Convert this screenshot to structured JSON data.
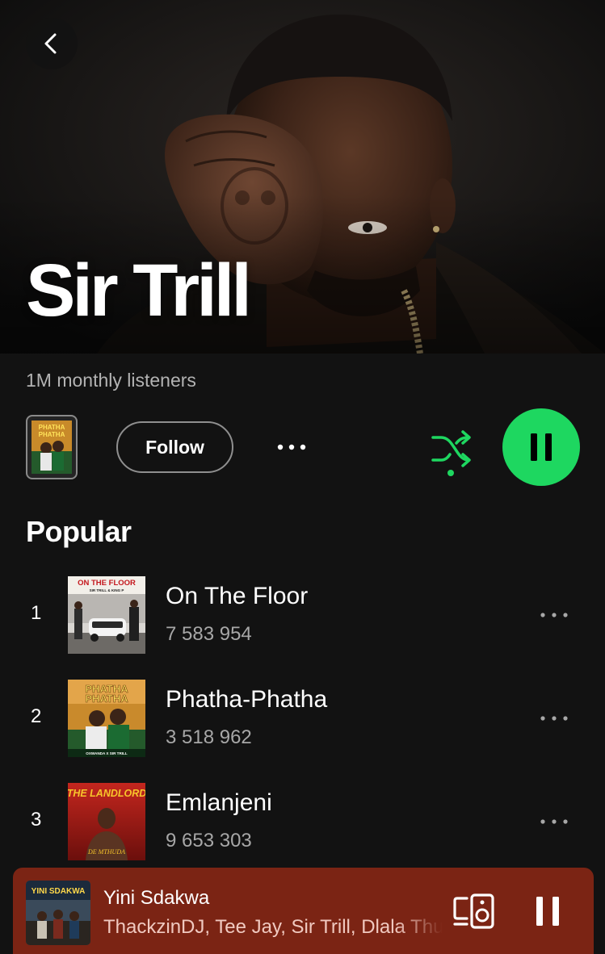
{
  "header": {
    "artist_name": "Sir Trill",
    "back_icon": "chevron-left-icon"
  },
  "artist_info": {
    "monthly_listeners": "1M monthly listeners"
  },
  "actions": {
    "mini_cover_lines": [
      "PHATHA",
      "PHATHA"
    ],
    "follow_label": "Follow",
    "more_icon": "more-horizontal-icon",
    "shuffle_icon": "shuffle-icon",
    "play_state_icon": "pause-icon"
  },
  "popular": {
    "heading": "Popular",
    "tracks": [
      {
        "rank": "1",
        "title": "On The Floor",
        "plays": "7 583 954",
        "cover_lines": [
          "ON THE FLOOR",
          "SIR TRILL & KING P"
        ]
      },
      {
        "rank": "2",
        "title": "Phatha-Phatha",
        "plays": "3 518 962",
        "cover_lines": [
          "PHATHA",
          "PHATHA",
          "OXWANDA X SIR TRILL"
        ]
      },
      {
        "rank": "3",
        "title": "Emlanjeni",
        "plays": "9 653 303",
        "cover_lines": [
          "THE LANDLORD",
          "DE MTHUDA"
        ]
      }
    ]
  },
  "now_playing": {
    "title": "Yini Sdakwa",
    "artists": "ThackzinDJ, Tee Jay, Sir Trill, Dlala Thukzin",
    "cover_lines": [
      "YINI SDAKWA"
    ],
    "device_icon": "connect-device-icon",
    "pause_icon": "pause-icon"
  },
  "colors": {
    "background": "#121212",
    "accent_green": "#1ed760",
    "secondary_text": "#b3b3b3",
    "now_playing_bar": "#7b2414"
  }
}
